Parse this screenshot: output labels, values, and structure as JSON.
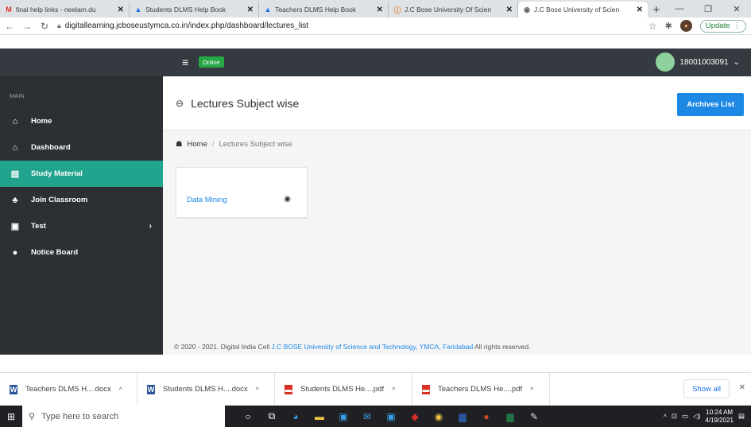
{
  "browser": {
    "tabs": [
      {
        "title": "final help links - neelam.du",
        "icon": "gmail-icon",
        "color": "#d93025"
      },
      {
        "title": "Students DLMS Help Book",
        "icon": "drive-icon",
        "color": "#1a73e8"
      },
      {
        "title": "Teachers DLMS Help Book",
        "icon": "drive-icon",
        "color": "#1a73e8"
      },
      {
        "title": "J.C Bose University Of Scien",
        "icon": "info-icon",
        "color": "#e8710a"
      },
      {
        "title": "J.C Bose University of Scien",
        "icon": "globe-icon",
        "color": "#5f6368"
      }
    ],
    "url": "digitallearning.jcboseustymca.co.in/index.php/dashboard/lectures_list",
    "update_label": "Update"
  },
  "topnav": {
    "status_badge": "Online",
    "user_id": "18001003091"
  },
  "sidebar": {
    "section_label": "MAIN",
    "items": [
      {
        "label": "Home",
        "icon": "home-icon"
      },
      {
        "label": "Dashboard",
        "icon": "dashboard-icon"
      },
      {
        "label": "Study Material",
        "icon": "book-icon"
      },
      {
        "label": "Join Classroom",
        "icon": "classroom-icon"
      },
      {
        "label": "Test",
        "icon": "test-icon"
      },
      {
        "label": "Notice Board",
        "icon": "notice-icon"
      }
    ],
    "active_item": "Study Material"
  },
  "page": {
    "title": "Lectures Subject wise",
    "archives_button": "Archives List",
    "breadcrumb": {
      "home": "Home",
      "current": "Lectures Subject wise"
    },
    "subjects": [
      {
        "name": "Data Mining"
      }
    ],
    "footer": {
      "prefix": "© 2020 - 2021. Digital India Cell ",
      "link": "J.C BOSE University of Science and Technology, YMCA, Faridabad",
      "suffix": " All rights reserved."
    }
  },
  "downloads": {
    "items": [
      {
        "name": "Teachers DLMS H....docx",
        "type": "doc"
      },
      {
        "name": "Students DLMS H....docx",
        "type": "doc"
      },
      {
        "name": "Students DLMS He....pdf",
        "type": "pdf"
      },
      {
        "name": "Teachers DLMS He....pdf",
        "type": "pdf"
      }
    ],
    "show_all": "Show all"
  },
  "taskbar": {
    "search_placeholder": "Type here to search",
    "time": "10:24 AM",
    "date": "4/19/2021"
  },
  "colors": {
    "accent": "#20a48d",
    "primary_button": "#1e88e5",
    "online": "#28a745",
    "topnav": "#343a40",
    "sidebar": "#2c3035"
  }
}
